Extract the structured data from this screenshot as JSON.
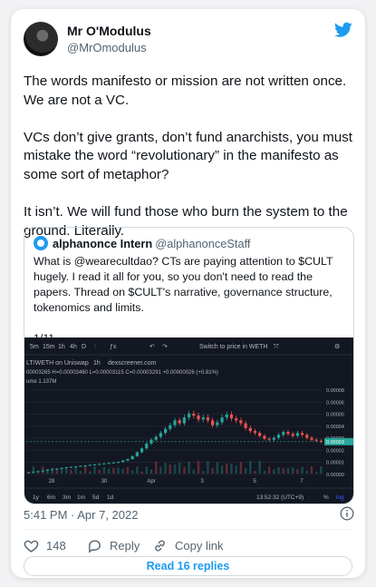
{
  "tweet": {
    "author_name": "Mr O'Modulus",
    "author_handle": "@MrOmodulus",
    "text": "The words manifesto or mission are not written once. We are not a VC.\n\nVCs don’t give grants, don’t fund anarchists, you must mistake the word “revolutionary” in the manifesto as some sort of metaphor?\n\nIt isn’t. We will fund those who burn the system to the ground. Literally.",
    "timestamp": "5:41 PM · Apr 7, 2022",
    "likes_count": "148",
    "reply_label": "Reply",
    "copy_link_label": "Copy link",
    "read_replies_label": "Read 16 replies"
  },
  "quoted": {
    "author_name": "alphanonce Intern",
    "author_handle": "@alphanonceStaff",
    "text": "What is @wearecultdao? CTs are paying attention to $CULT hugely. I read it all for you, so you don't need to read the papers. Thread on $CULT's narrative, governance structure, tokenomics and limits.\n\n1/11"
  },
  "chart_toolbar": {
    "intervals": [
      "5m",
      "15m",
      "1h",
      "4h",
      "D"
    ],
    "switch_label": "Switch to price in WETH"
  },
  "chart_header": {
    "pair": "LT/WETH on Uniswap",
    "interval": "1h",
    "source": "dexscreener.com",
    "ohlc": "00003265 H=0.00003460 L=0.00003115 C=0.00003291 +0.00000026 (+0.81%)",
    "volume": "ume 1.137M"
  },
  "chart_bottom": {
    "ranges": [
      "1y",
      "6m",
      "3m",
      "1m",
      "5d",
      "1d"
    ],
    "time": "13:52:32 (UTC+9)",
    "pct": "%",
    "log": "log"
  },
  "chart_data": {
    "type": "line",
    "title": "",
    "xlabel": "",
    "ylabel": "",
    "x_tick_labels": [
      "28",
      "30",
      "Apr",
      "3",
      "5",
      "7"
    ],
    "y_tick_labels": [
      "0.00008",
      "0.00006",
      "0.00005",
      "0.00004",
      "0.00003",
      "0.00002",
      "0.00001",
      "0.00000"
    ],
    "last_price_label": "0.00003",
    "series": [
      {
        "values": [
          1.5e-06,
          2e-06,
          2.5e-06,
          3e-06,
          4e-06,
          4.5e-06,
          5e-06,
          6e-06,
          6.5e-06,
          7e-06,
          7.5e-06,
          8e-06,
          8.5e-06,
          9e-06,
          9.5e-06,
          1e-05,
          1.05e-05,
          1.1e-05,
          1.15e-05,
          1.2e-05,
          1.35e-05,
          1.5e-05,
          1.8e-05,
          2.2e-05,
          2.6e-05,
          3.1e-05,
          3.5e-05,
          3.8e-05,
          4.2e-05,
          4.6e-05,
          5e-05,
          5.5e-05,
          5.2e-05,
          5.8e-05,
          6.2e-05,
          6e-05,
          5.6e-05,
          5.8e-05,
          5.5e-05,
          5e-05,
          5.3e-05,
          5.8e-05,
          6.1e-05,
          5.7e-05,
          5.5e-05,
          5.2e-05,
          4.7e-05,
          4.4e-05,
          4.2e-05,
          3.9e-05,
          3.6e-05,
          3.5e-05,
          3.7e-05,
          4e-05,
          4.3e-05,
          4.1e-05,
          3.9e-05,
          4.2e-05,
          4e-05,
          3.7e-05,
          3.5e-05,
          3.4e-05,
          3.3e-05
        ]
      }
    ],
    "ylim": [
      0,
      9e-05
    ]
  },
  "colors": {
    "brand_blue": "#1d9bf0",
    "chart_bg": "#131722",
    "candle_up": "#26a69a",
    "candle_down": "#ef5350"
  },
  "icons": {
    "twitter": "twitter-bird-icon",
    "info": "info-icon",
    "like": "heart-icon",
    "reply": "speech-bubble-icon",
    "copy_link": "link-icon"
  }
}
